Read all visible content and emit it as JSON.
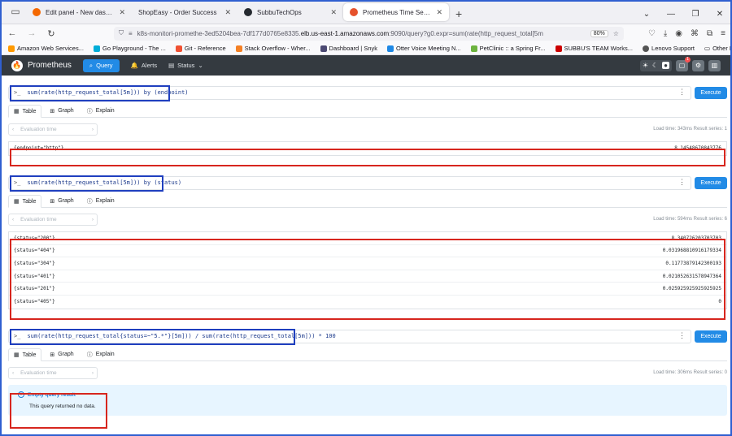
{
  "browser": {
    "tabs": [
      {
        "title": "Edit panel - New dashboard - D",
        "color": "#f46800"
      },
      {
        "title": "ShopEasy - Order Success",
        "color": ""
      },
      {
        "title": "SubbuTechOps",
        "color": "#24292f"
      },
      {
        "title": "Prometheus Time Series Collect",
        "color": "#e6522c"
      }
    ],
    "active_tab": 3,
    "url_prefix": "k8s-monitori-promethe-3ed5204bea-7df177d0765e8335.",
    "url_host": "elb.us-east-1.amazonaws.com",
    "url_rest": ":9090/query?g0.expr=sum(rate(http_request_total[5m",
    "zoom": "80%",
    "bookmarks": [
      {
        "label": "Amazon Web Services...",
        "color": "#ff9900"
      },
      {
        "label": "Go Playground - The ...",
        "color": "#00add8"
      },
      {
        "label": "Git - Reference",
        "color": "#f05032"
      },
      {
        "label": "Stack Overflow - Wher...",
        "color": "#f48024"
      },
      {
        "label": "Dashboard | Snyk",
        "color": "#4c4a73"
      },
      {
        "label": "Otter Voice Meeting N...",
        "color": "#1e88e5"
      },
      {
        "label": "PetClinic :: a Spring Fr...",
        "color": "#6db33f"
      },
      {
        "label": "SUBBU'S TEAM Works...",
        "color": "#cc0000"
      },
      {
        "label": "Lenovo Support",
        "color": "#555555"
      }
    ],
    "other_bookmarks": "Other Bookmarks"
  },
  "prom": {
    "brand": "Prometheus",
    "nav_query": "Query",
    "nav_alerts": "Alerts",
    "nav_status": "Status",
    "notif_count": "1"
  },
  "panels": [
    {
      "expr": "sum(rate(http_request_total[5m])) by (endpoint)",
      "execute": "Execute",
      "tab_table": "Table",
      "tab_graph": "Graph",
      "tab_explain": "Explain",
      "eval_placeholder": "Evaluation time",
      "stats": "Load time: 343ms   Result series: 1",
      "rows": [
        {
          "labels": "{endpoint=\"http\"}",
          "value": "8.14548670843776"
        }
      ]
    },
    {
      "expr": "sum(rate(http_request_total[5m])) by (status)",
      "execute": "Execute",
      "tab_table": "Table",
      "tab_graph": "Graph",
      "tab_explain": "Explain",
      "eval_placeholder": "Evaluation time",
      "stats": "Load time: 594ms   Result series: 6",
      "rows": [
        {
          "labels": "{status=\"200\"}",
          "value": "8.340726203703703"
        },
        {
          "labels": "{status=\"404\"}",
          "value": "0.031968810916179334"
        },
        {
          "labels": "{status=\"304\"}",
          "value": "0.11773879142300193"
        },
        {
          "labels": "{status=\"401\"}",
          "value": "0.021052631578947364"
        },
        {
          "labels": "{status=\"201\"}",
          "value": "0.025925925925925925"
        },
        {
          "labels": "{status=\"405\"}",
          "value": "0"
        }
      ]
    },
    {
      "expr": "sum(rate(http_request_total{status=~\"5.*\"}[5m])) / sum(rate(http_request_total[5m])) * 100",
      "execute": "Execute",
      "tab_table": "Table",
      "tab_graph": "Graph",
      "tab_explain": "Explain",
      "eval_placeholder": "Evaluation time",
      "stats": "Load time: 306ms   Result series: 0",
      "empty_title": "Empty query result",
      "empty_desc": "This query returned no data."
    }
  ]
}
